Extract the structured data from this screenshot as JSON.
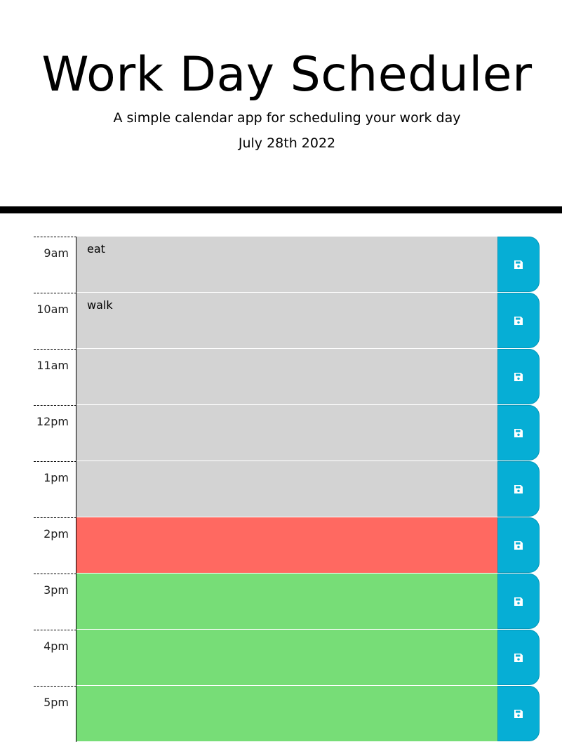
{
  "header": {
    "title": "Work Day Scheduler",
    "subtitle": "A simple calendar app for scheduling your work day",
    "current_day": "July 28th 2022"
  },
  "colors": {
    "past": "#d3d3d3",
    "present": "#ff6961",
    "future": "#77dd77",
    "save_button": "#06aed5"
  },
  "save_icon": "floppy-disk-icon",
  "time_blocks": [
    {
      "hour": "9am",
      "text": "eat",
      "status": "past"
    },
    {
      "hour": "10am",
      "text": "walk",
      "status": "past"
    },
    {
      "hour": "11am",
      "text": "",
      "status": "past"
    },
    {
      "hour": "12pm",
      "text": "",
      "status": "past"
    },
    {
      "hour": "1pm",
      "text": "",
      "status": "past"
    },
    {
      "hour": "2pm",
      "text": "",
      "status": "present"
    },
    {
      "hour": "3pm",
      "text": "",
      "status": "future"
    },
    {
      "hour": "4pm",
      "text": "",
      "status": "future"
    },
    {
      "hour": "5pm",
      "text": "",
      "status": "future"
    }
  ]
}
